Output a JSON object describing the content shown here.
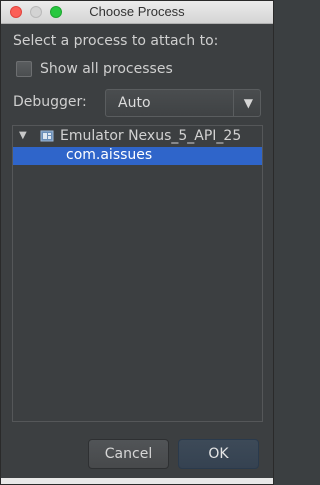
{
  "window": {
    "title": "Choose Process"
  },
  "form": {
    "prompt": "Select a process to attach to:",
    "show_all": {
      "label": "Show all processes",
      "checked": false
    },
    "debugger": {
      "label": "Debugger:",
      "value": "Auto"
    }
  },
  "tree": {
    "device": "Emulator Nexus_5_API_25",
    "processes": [
      {
        "name": "com.aissues",
        "selected": true
      }
    ]
  },
  "buttons": {
    "cancel": "Cancel",
    "ok": "OK"
  },
  "colors": {
    "selection": "#2f65ca",
    "background": "#3c3f41"
  }
}
